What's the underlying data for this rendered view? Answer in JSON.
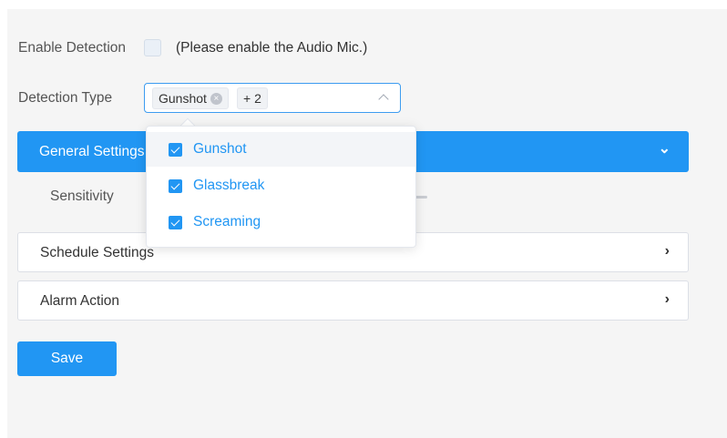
{
  "enable_detection": {
    "label": "Enable Detection",
    "checked": false,
    "hint": "(Please enable the Audio Mic.)"
  },
  "detection_type": {
    "label": "Detection Type",
    "selected_tag": "Gunshot",
    "more_tag": "+ 2",
    "options": [
      {
        "label": "Gunshot",
        "checked": true
      },
      {
        "label": "Glassbreak",
        "checked": true
      },
      {
        "label": "Screaming",
        "checked": true
      }
    ]
  },
  "sections": {
    "general": {
      "title": "General Settings",
      "chevron": "⌄"
    },
    "schedule": {
      "title": "Schedule Settings",
      "chevron": "›"
    },
    "alarm": {
      "title": "Alarm Action",
      "chevron": "›"
    }
  },
  "sensitivity": {
    "label": "Sensitivity"
  },
  "save_label": "Save",
  "colors": {
    "accent": "#2196f3",
    "background": "#f5f5f5"
  }
}
